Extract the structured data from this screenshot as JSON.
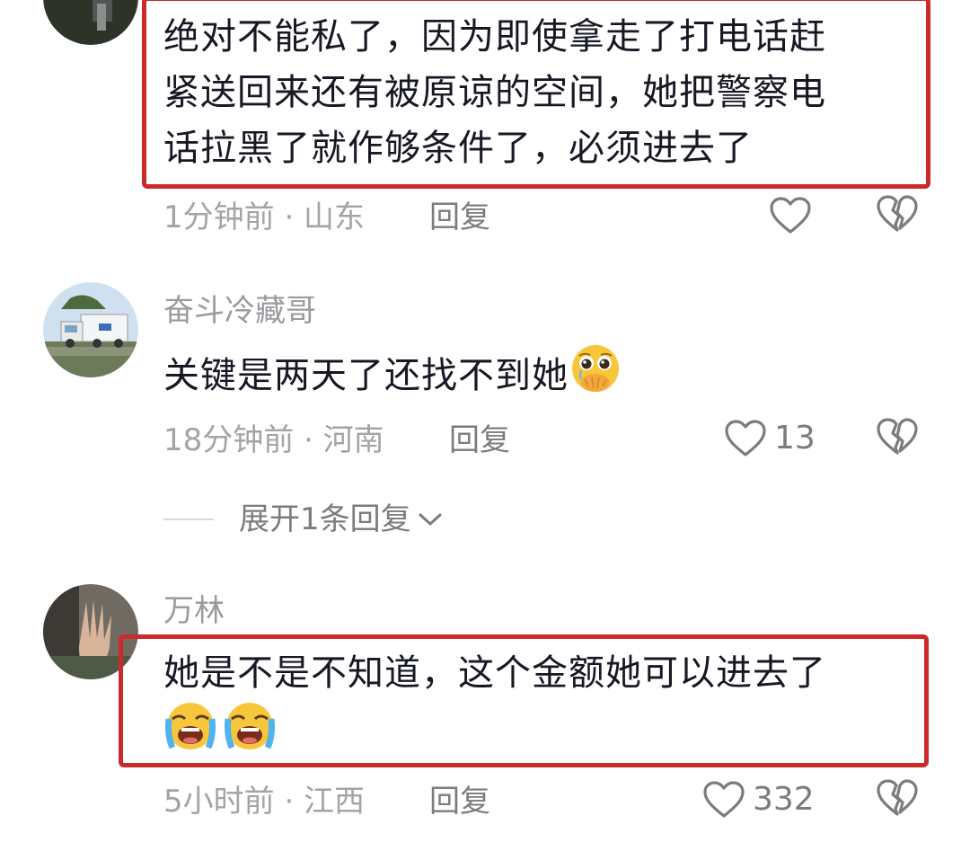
{
  "comments": [
    {
      "username": "",
      "lines": [
        "绝对不能私了，因为即使拿走了打电话赶",
        "紧送回来还有被原谅的空间，她把警察电",
        "话拉黑了就作够条件了，必须进去了"
      ],
      "meta": "1分钟前 · 山东",
      "reply": "回复",
      "likes": "",
      "highlighted": true
    },
    {
      "username": "奋斗冷藏哥",
      "lines": [
        "关键是两天了还找不到她"
      ],
      "emoji": "pleading-face-hands-over-mouth-icon",
      "meta": "18分钟前 · 河南",
      "reply": "回复",
      "likes": "13",
      "expand": "展开1条回复"
    },
    {
      "username": "万林",
      "lines": [
        "她是不是不知道，这个金额她可以进去了"
      ],
      "emoji": "loudly-crying-face-icon",
      "meta": "5小时前 · 江西",
      "reply": "回复",
      "likes": "332",
      "highlighted": true
    }
  ],
  "colors": {
    "highlight_border": "#cc2a2a",
    "meta_gray": "#a3a3a8",
    "text": "#161823"
  }
}
